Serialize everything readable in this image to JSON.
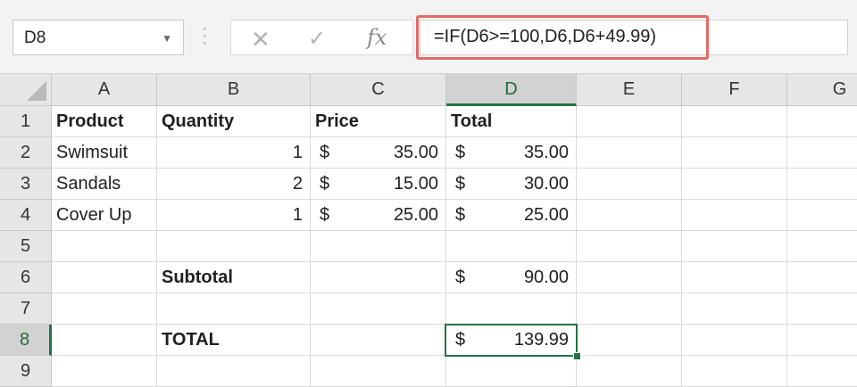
{
  "name_box": {
    "value": "D8",
    "dropdown_glyph": "▼"
  },
  "formula_bar": {
    "cancel_glyph": "✕",
    "enter_glyph": "✓",
    "fx_label": "fx",
    "formula": "=IF(D6>=100,D6,D6+49.99)",
    "highlight_color": "#e06b66"
  },
  "grid": {
    "selected_cell": "D8",
    "selection_color": "#217346",
    "columns": [
      {
        "label": "A"
      },
      {
        "label": "B"
      },
      {
        "label": "C"
      },
      {
        "label": "D"
      },
      {
        "label": "E"
      },
      {
        "label": "F"
      },
      {
        "label": "G"
      }
    ],
    "rows": [
      {
        "label": "1"
      },
      {
        "label": "2"
      },
      {
        "label": "3"
      },
      {
        "label": "4"
      },
      {
        "label": "5"
      },
      {
        "label": "6"
      },
      {
        "label": "7"
      },
      {
        "label": "8"
      },
      {
        "label": "9"
      }
    ],
    "headers": {
      "product": "Product",
      "quantity": "Quantity",
      "price": "Price",
      "total": "Total"
    },
    "items": [
      {
        "product": "Swimsuit",
        "quantity": "1",
        "price_cur": "$",
        "price": "35.00",
        "total_cur": "$",
        "total": "35.00"
      },
      {
        "product": "Sandals",
        "quantity": "2",
        "price_cur": "$",
        "price": "15.00",
        "total_cur": "$",
        "total": "30.00"
      },
      {
        "product": "Cover Up",
        "quantity": "1",
        "price_cur": "$",
        "price": "25.00",
        "total_cur": "$",
        "total": "25.00"
      }
    ],
    "subtotal": {
      "label": "Subtotal",
      "currency": "$",
      "value": "90.00"
    },
    "total": {
      "label": "TOTAL",
      "currency": "$",
      "value": "139.99"
    }
  }
}
